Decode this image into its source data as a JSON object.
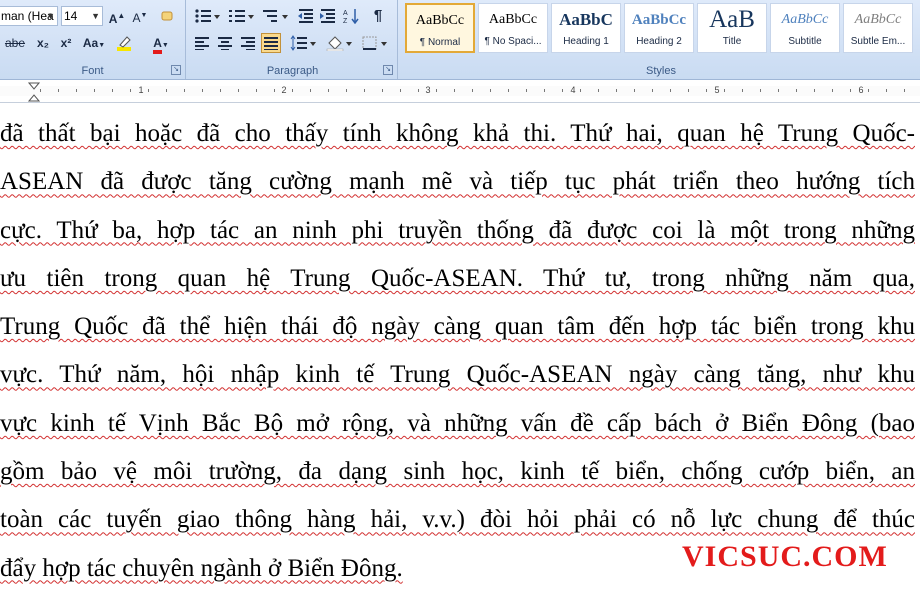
{
  "font_group": {
    "font_name": "man (Hea",
    "font_size": "14",
    "label": "Font",
    "btn_grow": "A",
    "btn_shrink": "A",
    "btn_strike": "abe",
    "btn_sub": "x₂",
    "btn_sup": "x²",
    "btn_case": "Aa",
    "btn_font_color": "A"
  },
  "paragraph_group": {
    "label": "Paragraph",
    "pilcrow": "¶"
  },
  "styles_group": {
    "label": "Styles",
    "items": [
      {
        "sample": "AaBbCc",
        "name": "¶ Normal",
        "color": "#000000"
      },
      {
        "sample": "AaBbCc",
        "name": "¶ No Spaci...",
        "color": "#000000"
      },
      {
        "sample": "AaBbC",
        "name": "Heading 1",
        "color": "#17365d"
      },
      {
        "sample": "AaBbCc",
        "name": "Heading 2",
        "color": "#4f81bd"
      },
      {
        "sample": "AaB",
        "name": "Title",
        "color": "#17365d"
      },
      {
        "sample": "AaBbCc",
        "name": "Subtitle",
        "color": "#4f81bd"
      },
      {
        "sample": "AaBbCc",
        "name": "Subtle Em...",
        "color": "#7f7f7f"
      }
    ]
  },
  "ruler": {
    "numbers": [
      "1",
      "2",
      "3",
      "4",
      "5",
      "6"
    ]
  },
  "document": {
    "lines": [
      "đã thất bại hoặc đã cho thấy tính không khả thi. Thứ hai, quan hệ Trung Quốc-",
      "ASEAN đã được tăng cường mạnh mẽ và tiếp tục phát triển theo hướng tích",
      "cực. Thứ ba, hợp tác an ninh phi truyền thống đã được coi là một trong những",
      "ưu tiên trong quan hệ Trung Quốc-ASEAN. Thứ tư, trong những năm qua,",
      "Trung Quốc đã thể hiện thái độ ngày càng quan tâm đến hợp tác biển trong khu",
      "vực. Thứ năm, hội nhập kinh tế Trung Quốc-ASEAN ngày càng tăng, như khu",
      "vực kinh tế Vịnh Bắc Bộ mở rộng, và những vấn đề cấp bách ở Biển Đông (bao",
      "gồm bảo vệ môi trường, đa dạng sinh học, kinh tế biển, chống cướp biển, an",
      "toàn các tuyến giao thông hàng hải, v.v.) đòi hỏi phải có nỗ lực chung để thúc",
      "đẩy hợp tác chuyên ngành ở Biển Đông."
    ]
  },
  "watermark": "VICSUC.COM",
  "colors": {
    "accent": "#e31b1b",
    "ribbon": "#dfeafa"
  }
}
